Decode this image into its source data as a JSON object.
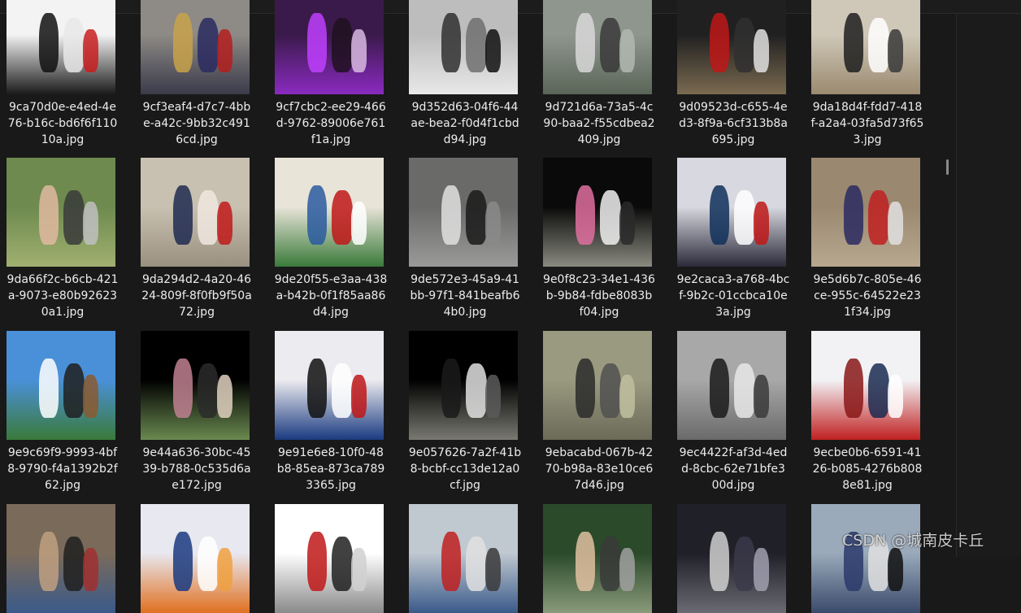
{
  "files": [
    {
      "caption": "9ca70d0e-e4ed-4e\n76-b16c-bd6f6f110\n10a.jpg"
    },
    {
      "caption": "9cf3eaf4-d7c7-4bb\ne-a42c-9bb32c491\n6cd.jpg"
    },
    {
      "caption": "9cf7cbc2-ee29-466\nd-9762-89006e761\nf1a.jpg"
    },
    {
      "caption": "9d352d63-04f6-44\nae-bea2-f0d4f1cbd\nd94.jpg"
    },
    {
      "caption": "9d721d6a-73a5-4c\n90-baa2-f55cdbea2\n409.jpg"
    },
    {
      "caption": "9d09523d-c655-4e\nd3-8f9a-6cf313b8a\n695.jpg"
    },
    {
      "caption": "9da18d4f-fdd7-418\nf-a2a4-03fa5d73f65\n3.jpg"
    },
    {
      "caption": "9da66f2c-b6cb-421\na-9073-e80b92623\n0a1.jpg"
    },
    {
      "caption": "9da294d2-4a20-46\n24-809f-8f0fb9f50a\n72.jpg"
    },
    {
      "caption": "9de20f55-e3aa-438\na-b42b-0f1f85aa86\nd4.jpg"
    },
    {
      "caption": "9de572e3-45a9-41\nbb-97f1-841beafb6\n4b0.jpg"
    },
    {
      "caption": "9e0f8c23-34e1-436\nb-9b84-fdbe8083b\nf04.jpg"
    },
    {
      "caption": "9e2caca3-a768-4bc\nf-9b2c-01ccbca10e\n3a.jpg"
    },
    {
      "caption": "9e5d6b7c-805e-46\nce-955c-64522e23\n1f34.jpg"
    },
    {
      "caption": "9e9c69f9-9993-4bf\n8-9790-f4a1392b2f\n62.jpg"
    },
    {
      "caption": "9e44a636-30bc-45\n39-b788-0c535d6a\ne172.jpg"
    },
    {
      "caption": "9e91e6e8-10f0-48\nb8-85ea-873ca789\n3365.jpg"
    },
    {
      "caption": "9e057626-7a2f-41b\n8-bcbf-cc13de12a0\ncf.jpg"
    },
    {
      "caption": "9ebacabd-067b-42\n70-b98a-83e10ce6\n7d46.jpg"
    },
    {
      "caption": "9ec4422f-af3d-4ed\nd-8cbc-62e71bfe3\n00d.jpg"
    },
    {
      "caption": "9ecbe0b6-6591-41\n26-b085-4276b808\n8e81.jpg"
    },
    {
      "caption": ""
    },
    {
      "caption": ""
    },
    {
      "caption": ""
    },
    {
      "caption": ""
    },
    {
      "caption": ""
    },
    {
      "caption": ""
    },
    {
      "caption": ""
    }
  ],
  "watermark": "CSDN @城南皮卡丘"
}
